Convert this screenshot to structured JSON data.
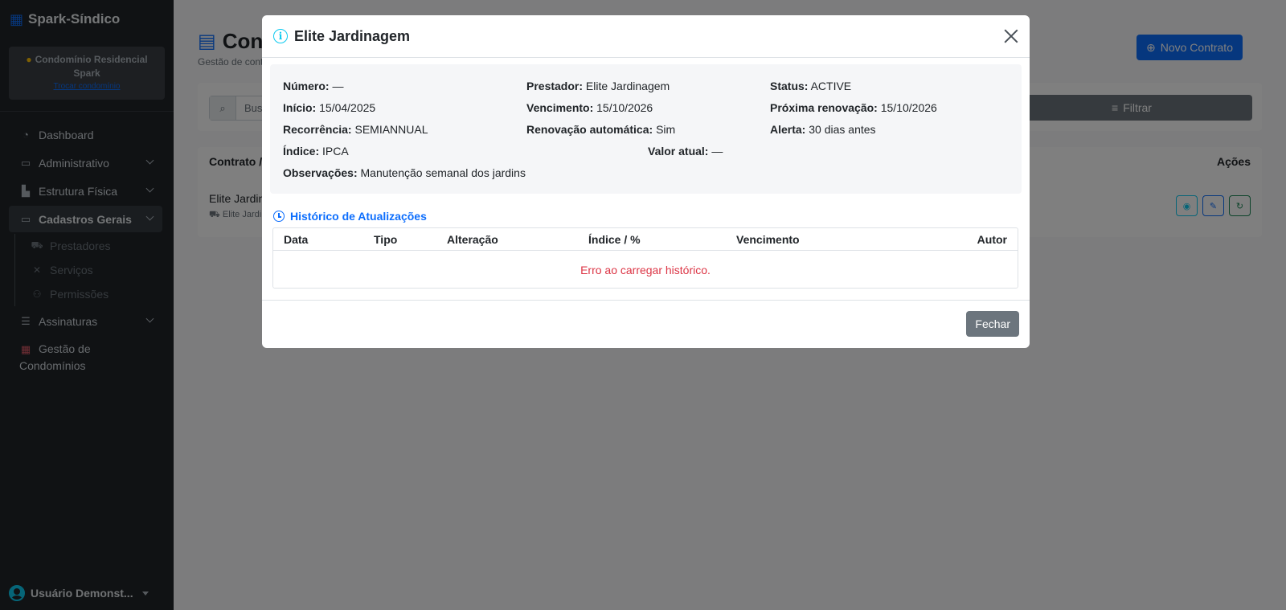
{
  "sidebar": {
    "brand": "Spark-Síndico",
    "condo_name": "Condomínio Residencial Spark",
    "condo_link": "Trocar condomínio",
    "items": [
      {
        "label": "Dashboard",
        "icon": "dashboard-icon"
      },
      {
        "label": "Administrativo",
        "icon": "briefcase-icon"
      },
      {
        "label": "Estrutura Física",
        "icon": "building-icon"
      },
      {
        "label": "Cadastros Gerais",
        "icon": "folder-icon"
      },
      {
        "label": "Assinaturas",
        "icon": "list-icon"
      },
      {
        "label": "Gestão de Condomínios",
        "icon": "building-grid-icon"
      }
    ],
    "subitems": [
      {
        "label": "Prestadores",
        "icon": "truck-icon"
      },
      {
        "label": "Serviços",
        "icon": "tools-icon"
      },
      {
        "label": "Permissões",
        "icon": "users-icon"
      }
    ],
    "user": "Usuário Demonst..."
  },
  "page": {
    "title": "Cont",
    "subtitle": "Gestão de cont",
    "new_button": "Novo Contrato",
    "search_placeholder": "Bus",
    "filter_button": "Filtrar",
    "col_contrato": "Contrato /",
    "col_acoes": "Ações",
    "row_name": "Elite Jardin",
    "row_sub": "Elite Jardin"
  },
  "modal": {
    "title": "Elite Jardinagem",
    "details": {
      "numero_label": "Número:",
      "numero": "—",
      "prestador_label": "Prestador:",
      "prestador": "Elite Jardinagem",
      "status_label": "Status:",
      "status": "ACTIVE",
      "inicio_label": "Início:",
      "inicio": "15/04/2025",
      "vencimento_label": "Vencimento:",
      "vencimento": "15/10/2026",
      "proxima_label": "Próxima renovação:",
      "proxima": "15/10/2026",
      "recorrencia_label": "Recorrência:",
      "recorrencia": "SEMIANNUAL",
      "renovacao_label": "Renovação automática:",
      "renovacao": "Sim",
      "alerta_label": "Alerta:",
      "alerta": "30 dias antes",
      "indice_label": "Índice:",
      "indice": "IPCA",
      "valor_label": "Valor atual:",
      "valor": "—",
      "obs_label": "Observações:",
      "obs": "Manutenção semanal dos jardins"
    },
    "history_title": "Histórico de Atualizações",
    "history_columns": [
      "Data",
      "Tipo",
      "Alteração",
      "Índice / %",
      "Vencimento",
      "Autor"
    ],
    "history_error": "Erro ao carregar histórico.",
    "close_button": "Fechar"
  }
}
